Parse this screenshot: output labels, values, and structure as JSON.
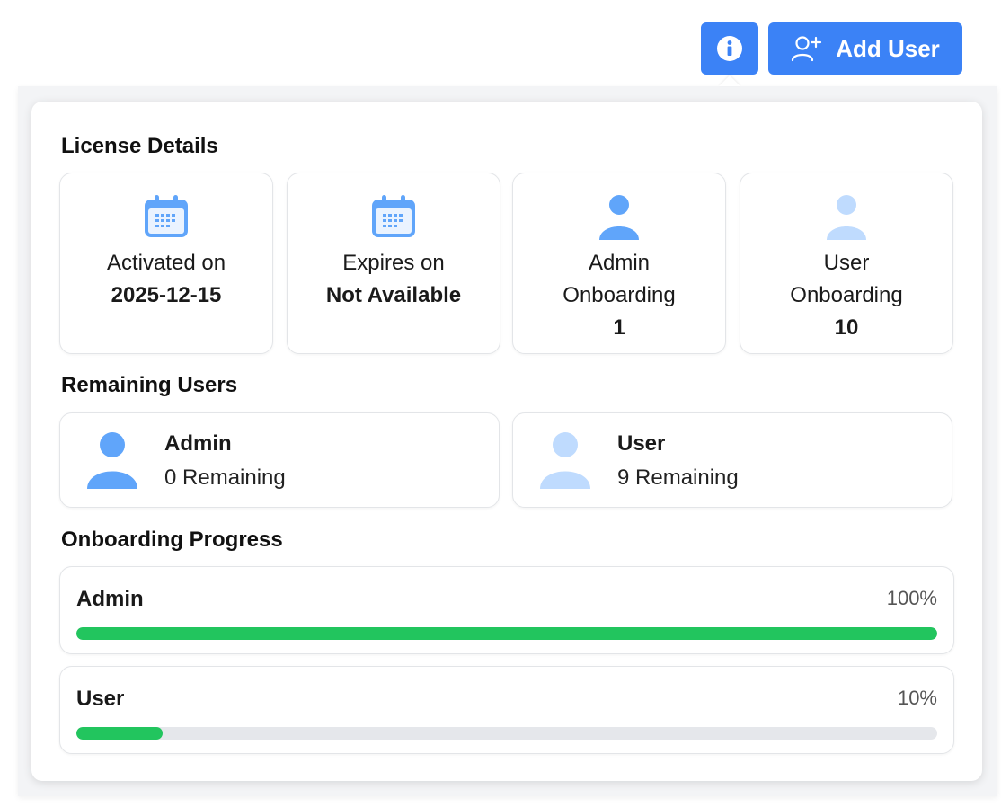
{
  "header": {
    "add_user_label": "Add User"
  },
  "license_details": {
    "title": "License Details",
    "cards": [
      {
        "icon": "calendar-icon",
        "label": "Activated on",
        "value": "2025-12-15"
      },
      {
        "icon": "calendar-icon",
        "label": "Expires on",
        "value": "Not Available"
      },
      {
        "icon": "admin-person-icon",
        "label_line1": "Admin",
        "label_line2": "Onboarding",
        "value": "1"
      },
      {
        "icon": "user-person-icon",
        "label_line1": "User",
        "label_line2": "Onboarding",
        "value": "10"
      }
    ]
  },
  "remaining_users": {
    "title": "Remaining Users",
    "items": [
      {
        "icon": "admin-person-icon",
        "name": "Admin",
        "remaining": "0 Remaining"
      },
      {
        "icon": "user-person-icon",
        "name": "User",
        "remaining": "9 Remaining"
      }
    ]
  },
  "onboarding_progress": {
    "title": "Onboarding Progress",
    "items": [
      {
        "name": "Admin",
        "percent_label": "100%",
        "percent": 100
      },
      {
        "name": "User",
        "percent_label": "10%",
        "percent": 10
      }
    ]
  },
  "colors": {
    "primary": "#3b82f6",
    "progress": "#22c55e",
    "track": "#e5e7eb",
    "admin_icon": "#60a5fa",
    "user_icon": "#bfdbfe"
  }
}
